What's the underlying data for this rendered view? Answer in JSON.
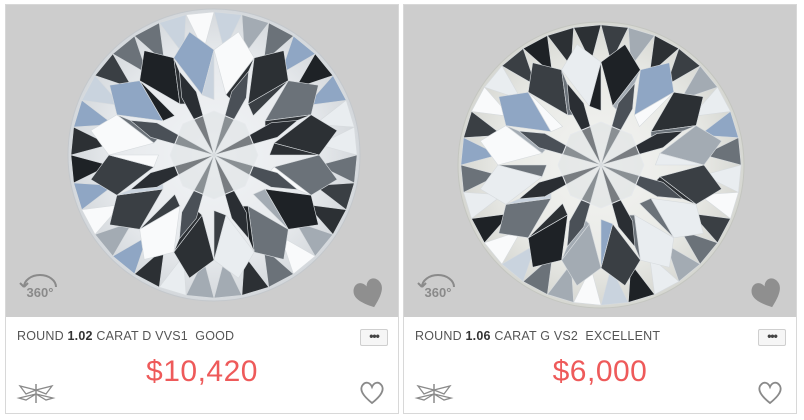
{
  "cards": [
    {
      "shape": "ROUND",
      "carat_value": "1.02",
      "carat_unit": "CARAT",
      "grade": "D VVS1  GOOD",
      "price": "$10,420",
      "badge_360": "360°",
      "more_label": "•••"
    },
    {
      "shape": "ROUND",
      "carat_value": "1.06",
      "carat_unit": "CARAT",
      "grade": "G VS2  EXCELLENT",
      "price": "$6,000",
      "badge_360": "360°",
      "more_label": "•••"
    }
  ],
  "colors": {
    "image_bg": "#cdcdcd",
    "price": "#ee5a5a",
    "text": "#555555",
    "icon": "#8a8a8a"
  },
  "icons": {
    "badge": "360-view-icon",
    "wishlist_image": "heart-solid-icon",
    "favorite": "heart-outline-icon",
    "brand": "dragonfly-logo-icon",
    "more": "more-options-icon"
  }
}
